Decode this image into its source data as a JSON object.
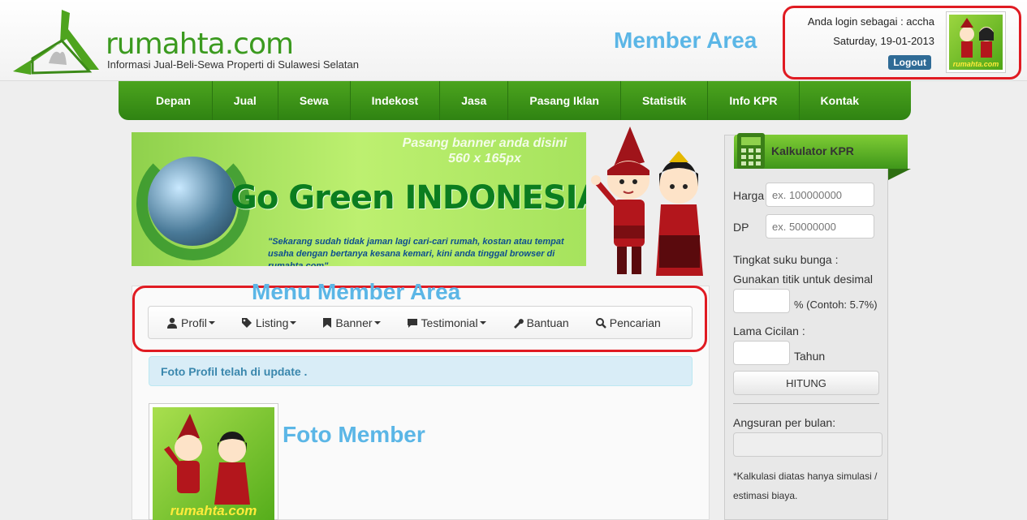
{
  "header": {
    "site_name": "rumahta.com",
    "tagline": "Informasi Jual-Beli-Sewa Properti di Sulawesi Selatan",
    "section_title": "Member Area",
    "login_text": "Anda login sebagai : accha",
    "date": "Saturday, 19-01-2013",
    "logout_label": "Logout",
    "avatar_label": "rumahta.com"
  },
  "nav": {
    "items": [
      "Depan",
      "Jual",
      "Sewa",
      "Indekost",
      "Jasa",
      "Pasang Iklan",
      "Statistik",
      "Info KPR",
      "Kontak"
    ]
  },
  "banner": {
    "hint_line1": "Pasang banner anda disini",
    "hint_line2": "560 x 165px",
    "title": "Go Green INDONESIA KU",
    "quote": "\"Sekarang sudah tidak jaman lagi cari-cari rumah, kostan atau tempat usaha dengan bertanya kesana kemari, kini anda tinggal browser di rumahta.com\""
  },
  "member_menu": {
    "title": "Menu Member Area",
    "items": [
      {
        "label": "Profil",
        "icon": "user-icon",
        "dropdown": true
      },
      {
        "label": "Listing",
        "icon": "tag-icon",
        "dropdown": true
      },
      {
        "label": "Banner",
        "icon": "bookmark-icon",
        "dropdown": true
      },
      {
        "label": "Testimonial",
        "icon": "comment-icon",
        "dropdown": true
      },
      {
        "label": "Bantuan",
        "icon": "wrench-icon",
        "dropdown": false
      },
      {
        "label": "Pencarian",
        "icon": "search-icon",
        "dropdown": false
      }
    ]
  },
  "alert": {
    "message": "Foto Profil telah di update ."
  },
  "profile_photo": {
    "caption": "Foto Member",
    "label": "rumahta.com"
  },
  "kpr": {
    "title": "Kalkulator KPR",
    "harga_label": "Harga",
    "harga_placeholder": "ex. 100000000",
    "dp_label": "DP",
    "dp_placeholder": "ex. 50000000",
    "bunga_label": "Tingkat suku bunga :",
    "bunga_hint": "Gunakan titik untuk desimal",
    "bunga_suffix": "% (Contoh: 5.7%)",
    "cicilan_label": "Lama Cicilan :",
    "cicilan_suffix": "Tahun",
    "button_label": "HITUNG",
    "angsuran_label": "Angsuran per bulan:",
    "note": "*Kalkulasi diatas hanya simulasi / estimasi biaya."
  },
  "colors": {
    "brand_green": "#3b9a1f",
    "annotation_blue": "#5bb6e6",
    "annotation_red": "#e01b22",
    "alert_text": "#3a87ad"
  }
}
